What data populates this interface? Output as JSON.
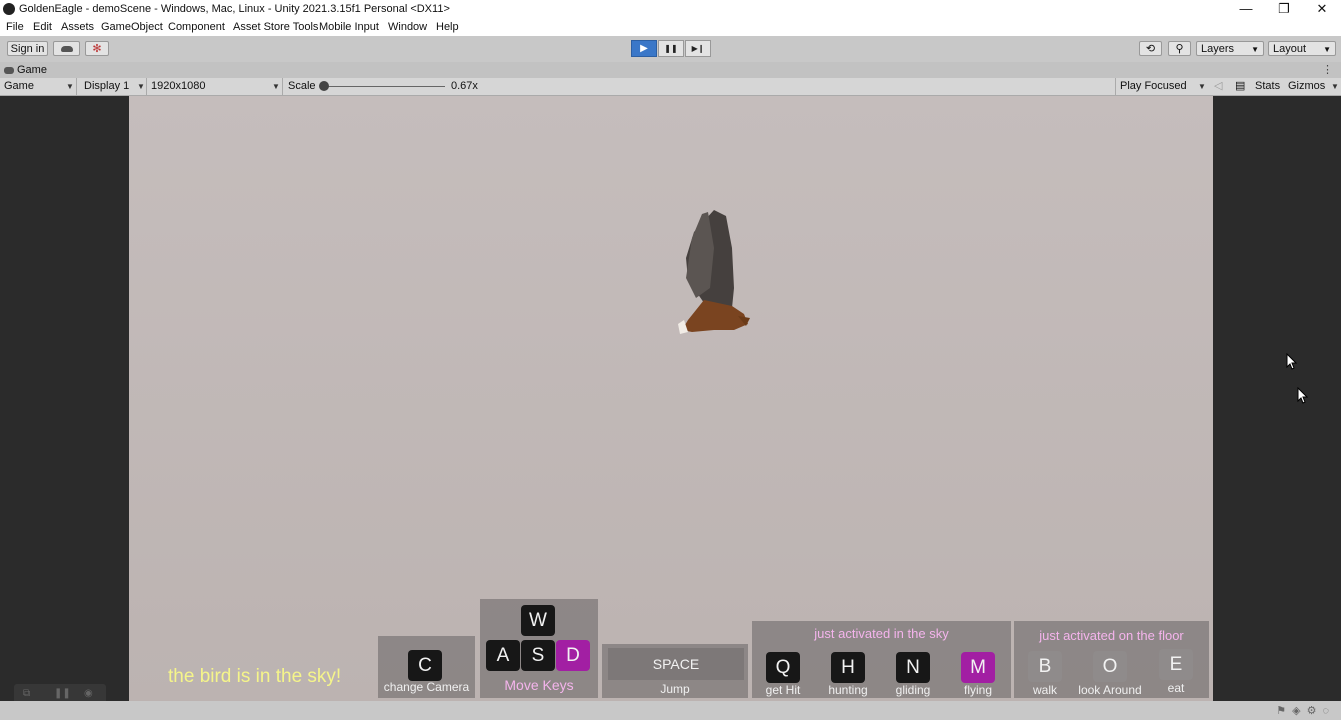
{
  "window": {
    "title": "GoldenEagle - demoScene - Windows, Mac, Linux - Unity 2021.3.15f1 Personal <DX11>",
    "controls": {
      "minimize": "—",
      "restore": "❐",
      "close": "✕"
    }
  },
  "menu": [
    "File",
    "Edit",
    "Assets",
    "GameObject",
    "Component",
    "Asset Store Tools",
    "Mobile Input",
    "Window",
    "Help"
  ],
  "toolbar": {
    "sign_in": "Sign in",
    "layers": "Layers",
    "layout": "Layout",
    "play": "▶",
    "pause": "❚❚",
    "step": "▶❙",
    "play_active": true
  },
  "game_tab": {
    "label": "Game",
    "menu": "⋮"
  },
  "game_toolbar": {
    "view": "Game",
    "display": "Display 1",
    "resolution": "1920x1080",
    "scale_label": "Scale",
    "scale_value": "0.67x",
    "play_mode": "Play Focused",
    "stats": "Stats",
    "gizmos": "Gizmos"
  },
  "hud": {
    "status": "the bird is in the sky!",
    "camera": {
      "key": "C",
      "label": "change Camera"
    },
    "move": {
      "keys": [
        "W",
        "A",
        "S",
        "D"
      ],
      "active": "D",
      "label": "Move Keys"
    },
    "jump": {
      "key": "SPACE",
      "label": "Jump"
    },
    "sky": {
      "title": "just activated in the sky",
      "keys": [
        {
          "key": "Q",
          "label": "get Hit",
          "active": false
        },
        {
          "key": "H",
          "label": "hunting",
          "active": false
        },
        {
          "key": "N",
          "label": "gliding",
          "active": false
        },
        {
          "key": "M",
          "label": "flying",
          "active": true
        }
      ]
    },
    "floor": {
      "title": "just activated on the floor",
      "keys": [
        {
          "key": "B",
          "label": "walk"
        },
        {
          "key": "O",
          "label": "look Around"
        },
        {
          "key": "E",
          "label": "eat"
        }
      ]
    }
  },
  "colors": {
    "active_key": "#a21fa3",
    "status_text": "#f5f58a",
    "panel_title": "#f4b4ec",
    "play_active": "#3a77c8"
  }
}
